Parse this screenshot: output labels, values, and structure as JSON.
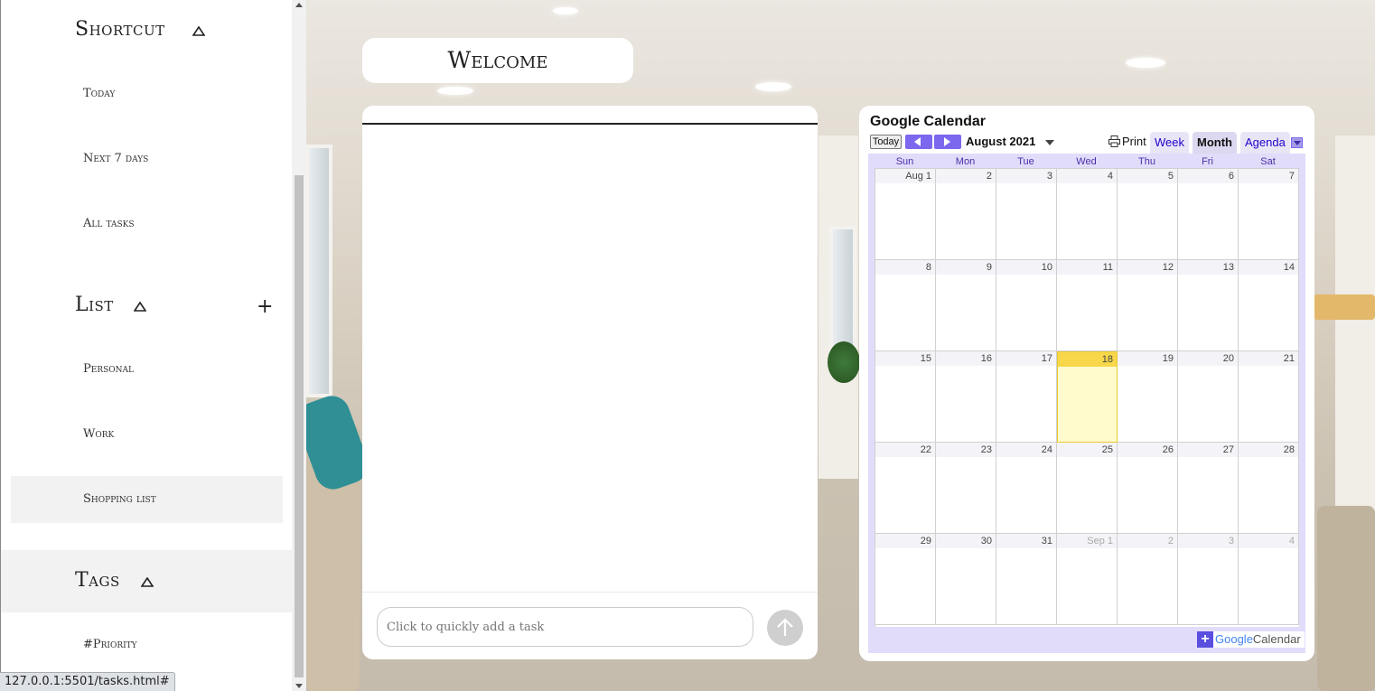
{
  "sidebar": {
    "shortcut_title": "Shortcut",
    "shortcut_items": [
      "Today",
      "Next 7 days",
      "All tasks"
    ],
    "list_title": "List",
    "list_items": [
      "Personal",
      "Work",
      "Shopping list"
    ],
    "tags_title": "Tags",
    "tag_items": [
      "#Priority"
    ]
  },
  "status_url": "127.0.0.1:5501/tasks.html#",
  "welcome": "Welcome",
  "task": {
    "placeholder": "Click to quickly add a task"
  },
  "calendar": {
    "title": "Google Calendar",
    "today_label": "Today",
    "month_label": "August 2021",
    "print_label": "Print",
    "tabs": [
      "Week",
      "Month",
      "Agenda"
    ],
    "active_tab": "Month",
    "day_names": [
      "Sun",
      "Mon",
      "Tue",
      "Wed",
      "Thu",
      "Fri",
      "Sat"
    ],
    "weeks": [
      [
        "Aug 1",
        "2",
        "3",
        "4",
        "5",
        "6",
        "7"
      ],
      [
        "8",
        "9",
        "10",
        "11",
        "12",
        "13",
        "14"
      ],
      [
        "15",
        "16",
        "17",
        "18",
        "19",
        "20",
        "21"
      ],
      [
        "22",
        "23",
        "24",
        "25",
        "26",
        "27",
        "28"
      ],
      [
        "29",
        "30",
        "31",
        "Sep 1",
        "2",
        "3",
        "4"
      ]
    ],
    "today_date": "18",
    "footer_logo_word1": "Google",
    "footer_logo_word2": "Calendar",
    "accent_color": "#7b68ee"
  }
}
